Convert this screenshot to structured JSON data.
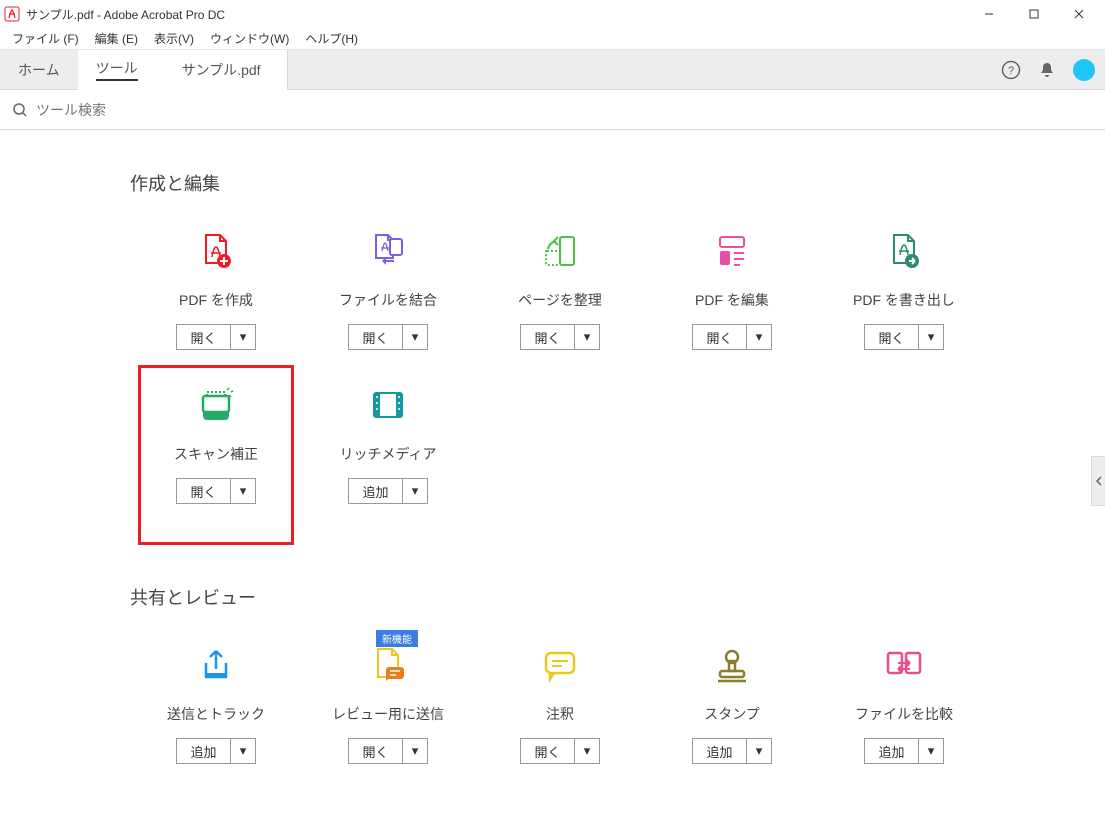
{
  "titlebar": {
    "title": "サンプル.pdf - Adobe Acrobat Pro DC"
  },
  "menubar": {
    "items": [
      "ファイル (F)",
      "編集 (E)",
      "表示(V)",
      "ウィンドウ(W)",
      "ヘルプ(H)"
    ]
  },
  "tabs": {
    "home": "ホーム",
    "tools": "ツール",
    "document": "サンプル.pdf"
  },
  "search": {
    "placeholder": "ツール検索"
  },
  "sections": {
    "create_edit": {
      "title": "作成と編集",
      "tools": [
        {
          "label": "PDF を作成",
          "action": "開く"
        },
        {
          "label": "ファイルを結合",
          "action": "開く"
        },
        {
          "label": "ページを整理",
          "action": "開く"
        },
        {
          "label": "PDF を編集",
          "action": "開く"
        },
        {
          "label": "PDF を書き出し",
          "action": "開く"
        },
        {
          "label": "スキャン補正",
          "action": "開く"
        },
        {
          "label": "リッチメディア",
          "action": "追加"
        }
      ]
    },
    "share_review": {
      "title": "共有とレビュー",
      "tools": [
        {
          "label": "送信とトラック",
          "action": "追加"
        },
        {
          "label": "レビュー用に送信",
          "action": "開く",
          "badge": "新機能"
        },
        {
          "label": "注釈",
          "action": "開く"
        },
        {
          "label": "スタンプ",
          "action": "追加"
        },
        {
          "label": "ファイルを比較",
          "action": "追加"
        }
      ]
    }
  }
}
